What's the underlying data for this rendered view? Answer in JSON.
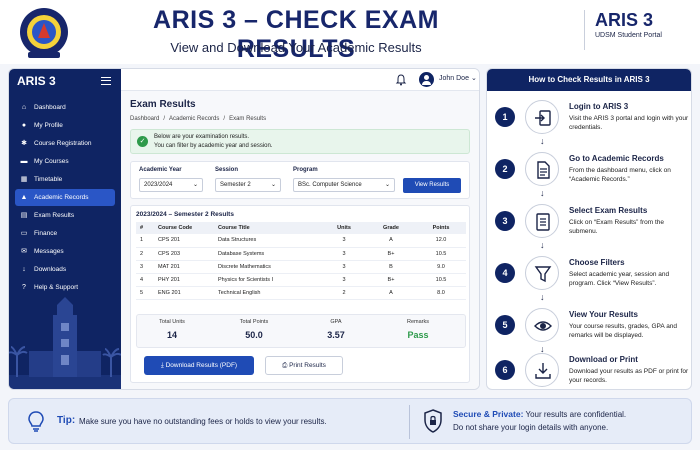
{
  "header": {
    "title": "ARIS 3 – CHECK EXAM RESULTS",
    "subtitle": "View and Download Your Academic Results",
    "brand_name": "ARIS 3",
    "brand_sub": "UDSM Student Portal"
  },
  "sidebar": {
    "title": "ARIS 3",
    "items": [
      {
        "label": "Dashboard",
        "icon": "home-icon",
        "active": false
      },
      {
        "label": "My Profile",
        "icon": "user-icon",
        "active": false
      },
      {
        "label": "Course Registration",
        "icon": "gear-icon",
        "active": false
      },
      {
        "label": "My Courses",
        "icon": "folder-icon",
        "active": false
      },
      {
        "label": "Timetable",
        "icon": "calendar-icon",
        "active": false
      },
      {
        "label": "Academic Records",
        "icon": "cap-icon",
        "active": true
      },
      {
        "label": "Exam Results",
        "icon": "document-icon",
        "active": false
      },
      {
        "label": "Finance",
        "icon": "card-icon",
        "active": false
      },
      {
        "label": "Messages",
        "icon": "mail-icon",
        "active": false
      },
      {
        "label": "Downloads",
        "icon": "download-icon",
        "active": false
      },
      {
        "label": "Help & Support",
        "icon": "help-icon",
        "active": false
      }
    ]
  },
  "topbar": {
    "user_name": "John Doe"
  },
  "main": {
    "title": "Exam Results",
    "breadcrumb": [
      "Dashboard",
      "Academic Records",
      "Exam Results"
    ],
    "alert_line1": "Below are your examination results.",
    "alert_line2": "You can filter by academic year and session."
  },
  "filters": {
    "year_label": "Academic Year",
    "year_value": "2023/2024",
    "session_label": "Session",
    "session_value": "Semester 2",
    "program_label": "Program",
    "program_value": "BSc. Computer Science",
    "view_button": "View Results"
  },
  "results": {
    "title": "2023/2024 – Semester 2 Results",
    "headers": [
      "#",
      "Course Code",
      "Course Title",
      "Units",
      "Grade",
      "Points"
    ],
    "rows": [
      [
        "1",
        "CPS 201",
        "Data Structures",
        "3",
        "A",
        "12.0"
      ],
      [
        "2",
        "CPS 203",
        "Database Systems",
        "3",
        "B+",
        "10.5"
      ],
      [
        "3",
        "MAT 201",
        "Discrete Mathematics",
        "3",
        "B",
        "9.0"
      ],
      [
        "4",
        "PHY 201",
        "Physics for Scientists I",
        "3",
        "B+",
        "10.5"
      ],
      [
        "5",
        "ENG 201",
        "Technical English",
        "2",
        "A",
        "8.0"
      ]
    ],
    "summary": {
      "total_units_label": "Total Units",
      "total_units": "14",
      "total_points_label": "Total Points",
      "total_points": "50.0",
      "gpa_label": "GPA",
      "gpa": "3.57",
      "remarks_label": "Remarks",
      "remarks": "Pass"
    },
    "download_button": "Download Results (PDF)",
    "print_button": "Print Results"
  },
  "steps": {
    "title": "How to Check Results in ARIS 3",
    "items": [
      {
        "num": "1",
        "title": "Login to ARIS 3",
        "desc": "Visit the ARIS 3 portal and login with your credentials.",
        "icon": "login-icon"
      },
      {
        "num": "2",
        "title": "Go to Academic Records",
        "desc": "From the dashboard menu, click on “Academic Records.”",
        "icon": "document-icon"
      },
      {
        "num": "3",
        "title": "Select Exam Results",
        "desc": "Click on “Exam Results” from the submenu.",
        "icon": "list-icon"
      },
      {
        "num": "4",
        "title": "Choose Filters",
        "desc": "Select academic year, session and program. Click “View Results”.",
        "icon": "filter-icon"
      },
      {
        "num": "5",
        "title": "View Your Results",
        "desc": "Your course results, grades, GPA and remarks will be displayed.",
        "icon": "eye-icon"
      },
      {
        "num": "6",
        "title": "Download or Print",
        "desc": "Download your results as PDF or print for your records.",
        "icon": "download-icon"
      }
    ]
  },
  "footer": {
    "tip_label": "Tip:",
    "tip_text": "Make sure you have no outstanding fees or holds to view your results.",
    "secure_label": "Secure & Private:",
    "secure_text1": "Your results are confidential.",
    "secure_text2": "Do not share your login details with anyone."
  },
  "colors": {
    "navy": "#0f2463",
    "accent": "#1f4bb5",
    "pass": "#2e9a4b"
  }
}
